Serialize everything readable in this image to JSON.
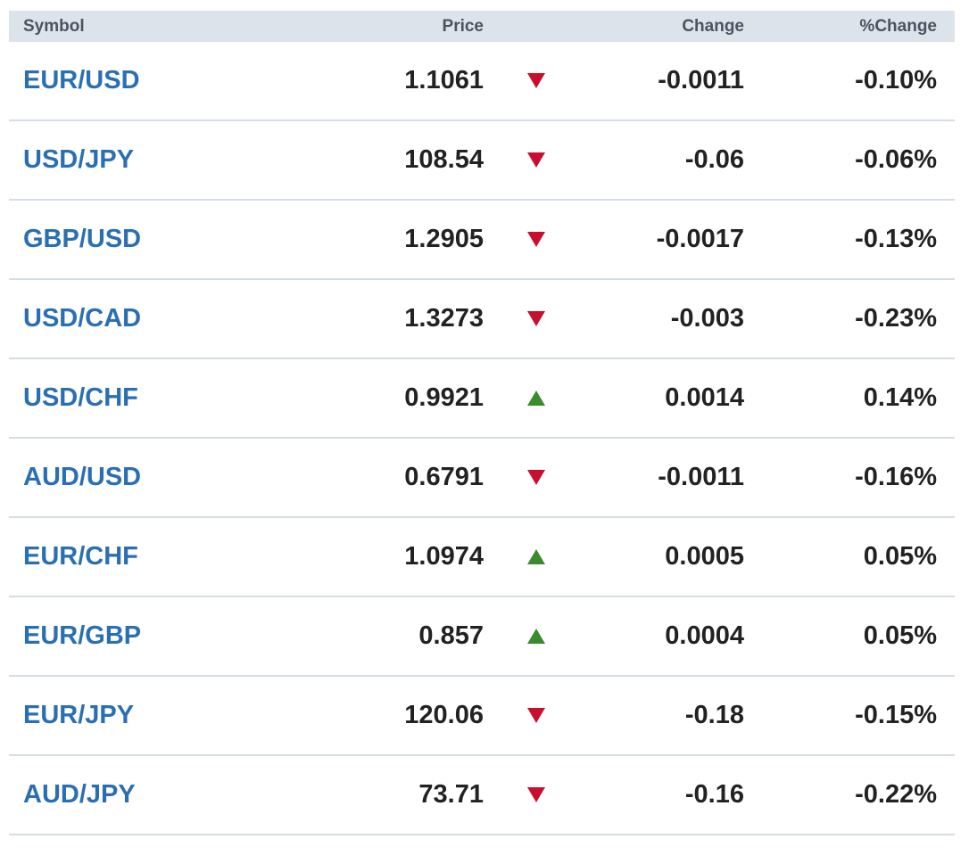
{
  "header": {
    "symbol": "Symbol",
    "price": "Price",
    "change": "Change",
    "pct_change": "%Change"
  },
  "colors": {
    "link": "#2b6fb3",
    "down": "#c8102e",
    "up": "#3c8a2e",
    "header_bg": "#dde3ea"
  },
  "rows": [
    {
      "symbol": "EUR/USD",
      "price": "1.1061",
      "direction": "down",
      "icon": "down-triangle-icon",
      "change": "-0.0011",
      "pct": "-0.10%"
    },
    {
      "symbol": "USD/JPY",
      "price": "108.54",
      "direction": "down",
      "icon": "down-triangle-icon",
      "change": "-0.06",
      "pct": "-0.06%"
    },
    {
      "symbol": "GBP/USD",
      "price": "1.2905",
      "direction": "down",
      "icon": "down-triangle-icon",
      "change": "-0.0017",
      "pct": "-0.13%"
    },
    {
      "symbol": "USD/CAD",
      "price": "1.3273",
      "direction": "down",
      "icon": "down-triangle-icon",
      "change": "-0.003",
      "pct": "-0.23%"
    },
    {
      "symbol": "USD/CHF",
      "price": "0.9921",
      "direction": "up",
      "icon": "up-triangle-icon",
      "change": "0.0014",
      "pct": "0.14%"
    },
    {
      "symbol": "AUD/USD",
      "price": "0.6791",
      "direction": "down",
      "icon": "down-triangle-icon",
      "change": "-0.0011",
      "pct": "-0.16%"
    },
    {
      "symbol": "EUR/CHF",
      "price": "1.0974",
      "direction": "up",
      "icon": "up-triangle-icon",
      "change": "0.0005",
      "pct": "0.05%"
    },
    {
      "symbol": "EUR/GBP",
      "price": "0.857",
      "direction": "up",
      "icon": "up-triangle-icon",
      "change": "0.0004",
      "pct": "0.05%"
    },
    {
      "symbol": "EUR/JPY",
      "price": "120.06",
      "direction": "down",
      "icon": "down-triangle-icon",
      "change": "-0.18",
      "pct": "-0.15%"
    },
    {
      "symbol": "AUD/JPY",
      "price": "73.71",
      "direction": "down",
      "icon": "down-triangle-icon",
      "change": "-0.16",
      "pct": "-0.22%"
    }
  ]
}
